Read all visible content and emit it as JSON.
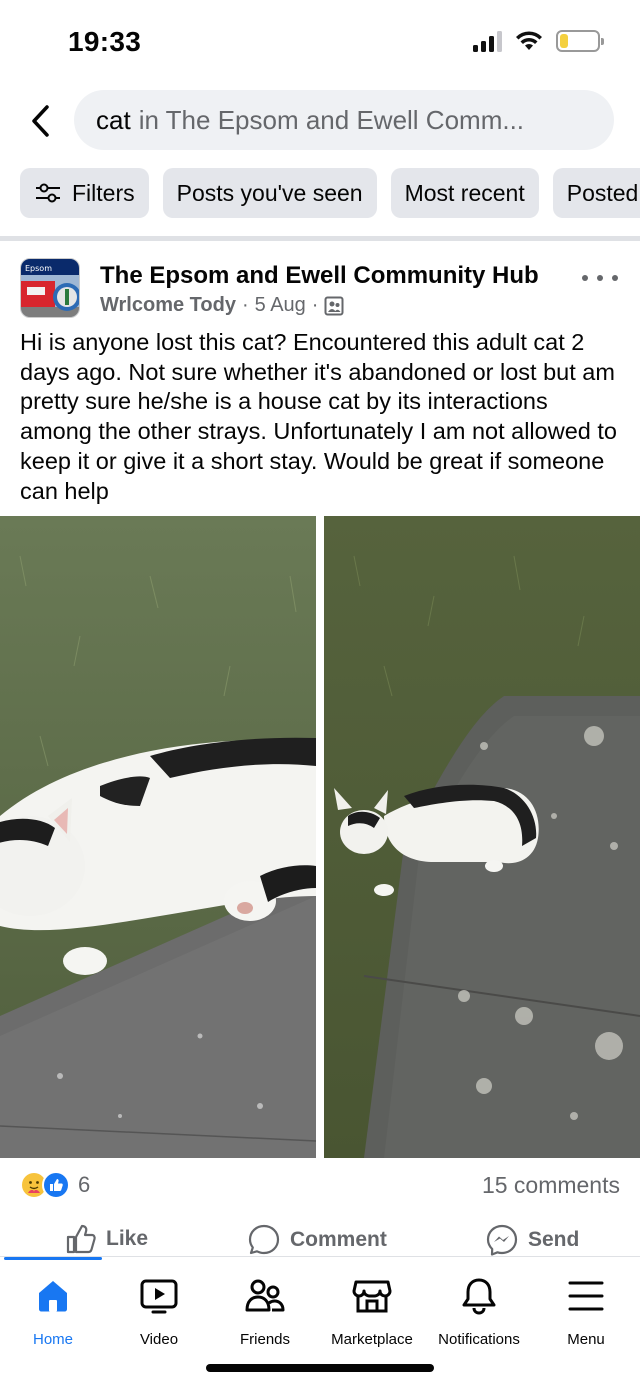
{
  "status_bar": {
    "time": "19:33"
  },
  "search": {
    "query": "cat",
    "scope": "in The Epsom and Ewell Comm..."
  },
  "filters": [
    "Filters",
    "Posts you've seen",
    "Most recent",
    "Posted"
  ],
  "post": {
    "group_name": "The Epsom and Ewell Community Hub",
    "author": "Wrlcome Tody",
    "date": "5 Aug",
    "text": "Hi is anyone lost this cat? Encountered this adult cat 2 days ago. Not sure whether it's abandoned or lost but am pretty sure he/she is a house cat by its interactions among the other strays. Unfortunately I am not allowed to keep it or give it a short stay. Would be great if someone can help",
    "reaction_count": "6",
    "comments_count": "15 comments",
    "avatar_sign_text": "Epsom"
  },
  "actions": {
    "like": "Like",
    "comment": "Comment",
    "send": "Send"
  },
  "nav": {
    "home": "Home",
    "video": "Video",
    "friends": "Friends",
    "marketplace": "Marketplace",
    "notifications": "Notifications",
    "menu": "Menu"
  },
  "colors": {
    "accent": "#1877f2",
    "secondary_text": "#65676b",
    "chip_bg": "#e4e6eb"
  }
}
